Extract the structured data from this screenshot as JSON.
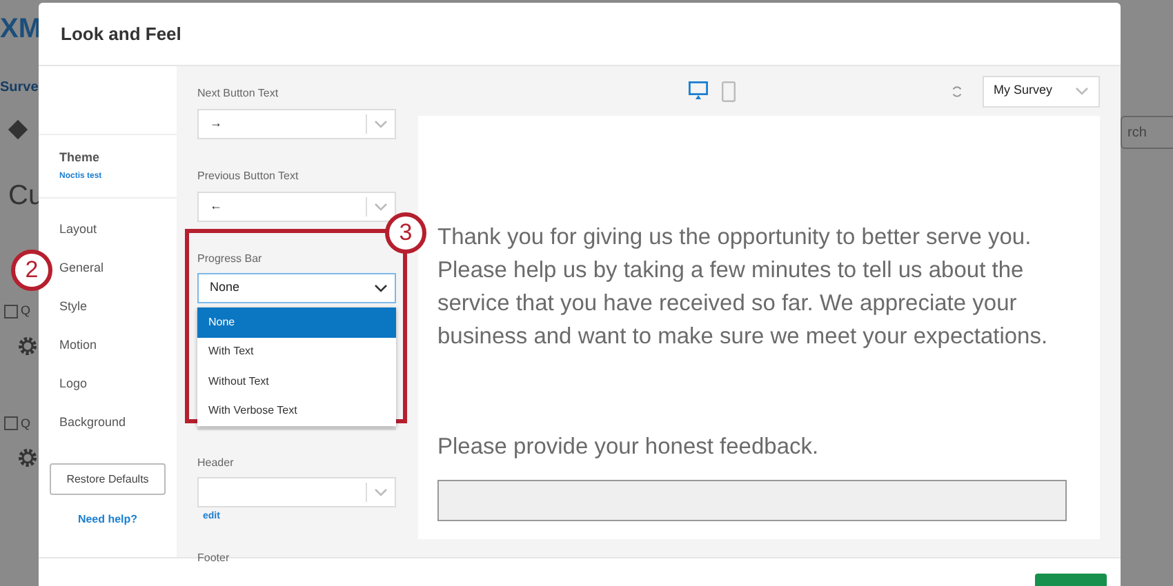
{
  "background": {
    "logo": "XM",
    "tab": "Surve",
    "heading": "Cu",
    "search_button": "rch",
    "questions": [
      {
        "label": "Q",
        "checked": false
      },
      {
        "label": "Q",
        "checked": false
      }
    ]
  },
  "dialog": {
    "title": "Look and Feel"
  },
  "sidebar": {
    "theme_label": "Theme",
    "theme_name": "Noctis test",
    "items": [
      {
        "label": "Layout"
      },
      {
        "label": "General"
      },
      {
        "label": "Style"
      },
      {
        "label": "Motion"
      },
      {
        "label": "Logo"
      },
      {
        "label": "Background"
      }
    ],
    "restore_button": "Restore Defaults",
    "help_link": "Need help?"
  },
  "form": {
    "next_button": {
      "label": "Next Button Text",
      "value": "→"
    },
    "previous_button": {
      "label": "Previous Button Text",
      "value": "←"
    },
    "progress_bar": {
      "label": "Progress Bar",
      "value": "None",
      "expanded": true,
      "options": [
        {
          "label": "None",
          "selected": true
        },
        {
          "label": "With Text",
          "selected": false
        },
        {
          "label": "Without Text",
          "selected": false
        },
        {
          "label": "With Verbose Text",
          "selected": false
        }
      ]
    },
    "header": {
      "label": "Header",
      "edit_link": "edit"
    },
    "footer_label": "Footer"
  },
  "preview": {
    "devices": [
      {
        "kind": "desktop",
        "selected": true
      },
      {
        "kind": "mobile",
        "selected": false
      }
    ],
    "survey_select": "My Survey",
    "paragraphs": [
      "Thank you for giving us the opportunity to better serve you. Please help us by taking a few minutes to tell us about the service that you have received so far. We appreciate your business and want to make sure we meet your expectations.",
      "Please provide your honest feedback."
    ]
  },
  "callouts": [
    {
      "number": "2"
    },
    {
      "number": "3"
    }
  ]
}
